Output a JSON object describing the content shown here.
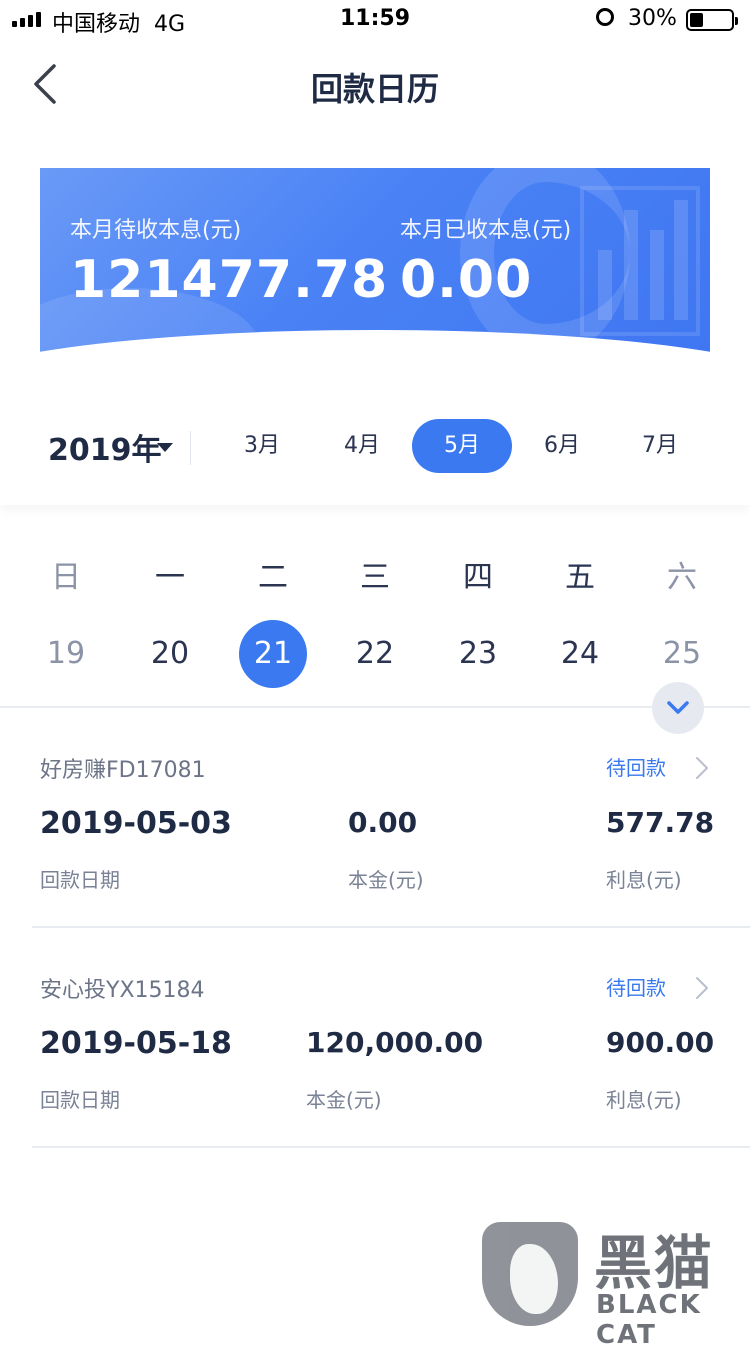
{
  "status_bar": {
    "carrier": "中国移动",
    "network": "4G",
    "time": "11:59",
    "battery_percent": "30%",
    "battery_level": 0.3,
    "icons": [
      "signal-icon",
      "alarm-icon",
      "battery-icon"
    ]
  },
  "header": {
    "title": "回款日历",
    "back_icon": "chevron-left-icon"
  },
  "summary": {
    "pending_label": "本月待收本息(元)",
    "pending_value": "121477.78",
    "received_label": "本月已收本息(元)",
    "received_value": "0.00",
    "accent": "#3a79f0"
  },
  "month_selector": {
    "year": "2019年",
    "months": [
      "3月",
      "4月",
      "5月",
      "6月",
      "7月"
    ],
    "selected_month": "5月"
  },
  "week": {
    "weekdays": [
      "日",
      "一",
      "二",
      "三",
      "四",
      "五",
      "六"
    ],
    "days": [
      "19",
      "20",
      "21",
      "22",
      "23",
      "24",
      "25"
    ],
    "selected_day": "21"
  },
  "records": [
    {
      "name": "好房赚FD17081",
      "status": "待回款",
      "date": "2019-05-03",
      "date_label": "回款日期",
      "principal": "0.00",
      "principal_label": "本金(元)",
      "interest": "577.78",
      "interest_label": "利息(元)"
    },
    {
      "name": "安心投YX15184",
      "status": "待回款",
      "date": "2019-05-18",
      "date_label": "回款日期",
      "principal": "120,000.00",
      "principal_label": "本金(元)",
      "interest": "900.00",
      "interest_label": "利息(元)"
    }
  ],
  "watermark": {
    "name": "黑猫",
    "sub": "BLACK CAT"
  }
}
